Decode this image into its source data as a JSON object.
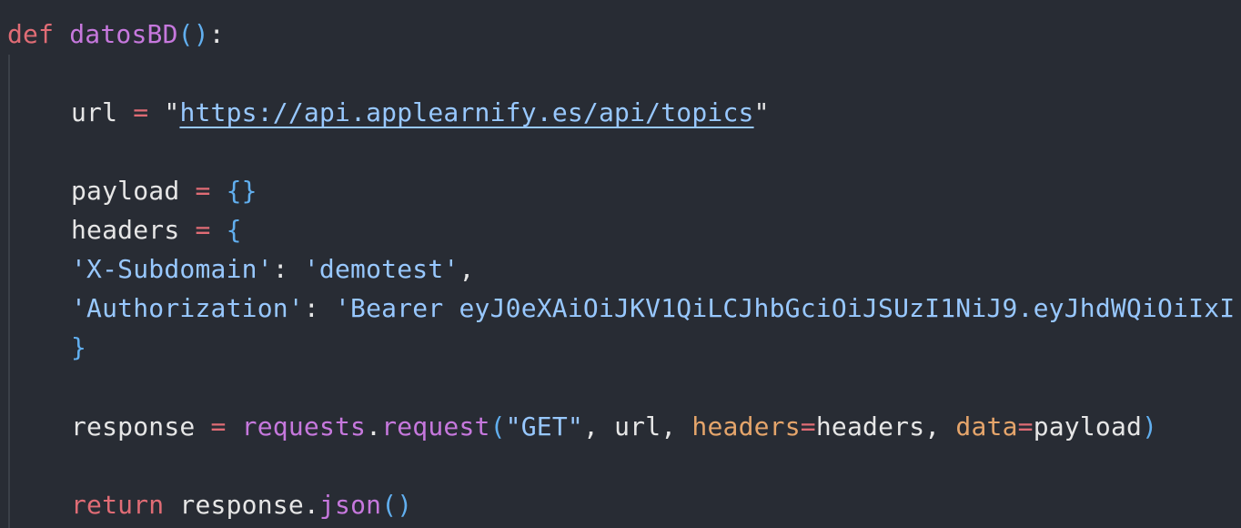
{
  "code": {
    "line1": {
      "def_kw": "def",
      "func_name": "datosBD",
      "parens": "()",
      "colon": ":"
    },
    "line2": {
      "var": "url",
      "eq": "=",
      "q_open": "\"",
      "url": "https://api.applearnify.es/api/topics",
      "q_close": "\""
    },
    "line3": {
      "var": "payload",
      "eq": "=",
      "braces": "{}"
    },
    "line4": {
      "var": "headers",
      "eq": "=",
      "brace_open": "{"
    },
    "line5": {
      "key": "'X-Subdomain'",
      "colon": ":",
      "value": "'demotest'",
      "comma": ","
    },
    "line6": {
      "key": "'Authorization'",
      "colon": ":",
      "value": "'Bearer eyJ0eXAiOiJKV1QiLCJhbGciOiJSUzI1NiJ9.eyJhdWQiOiIxI"
    },
    "line7": {
      "brace_close": "}"
    },
    "line8": {
      "var": "response",
      "eq": "=",
      "module": "requests",
      "dot": ".",
      "method": "request",
      "paren_open": "(",
      "method_str": "\"GET\"",
      "sep1": ", ",
      "arg_url": "url",
      "sep2": ", ",
      "kw_headers": "headers",
      "eq2": "=",
      "val_headers": "headers",
      "sep3": ", ",
      "kw_data": "data",
      "eq3": "=",
      "val_data": "payload",
      "paren_close": ")"
    },
    "line9": {
      "return_kw": "return",
      "obj": "response",
      "dot": ".",
      "method": "json",
      "parens": "()"
    }
  }
}
